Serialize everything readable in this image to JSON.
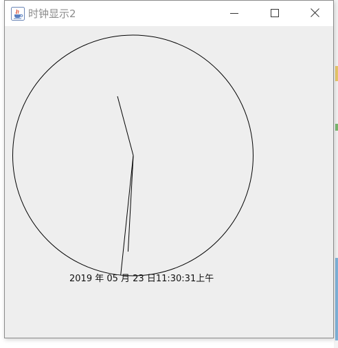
{
  "window": {
    "title": "时钟显示2",
    "app_icon": "java-coffee-icon",
    "controls": {
      "minimize_icon": "minimize-icon",
      "maximize_icon": "maximize-icon",
      "close_icon": "close-icon"
    }
  },
  "clock": {
    "date_text": "2019 年 05 月 23 日11:30:31上午",
    "hour": 11,
    "minute": 30,
    "second": 31,
    "colors": {
      "face_stroke": "#000000",
      "hands": "#000000",
      "background": "#eeeeee"
    }
  }
}
